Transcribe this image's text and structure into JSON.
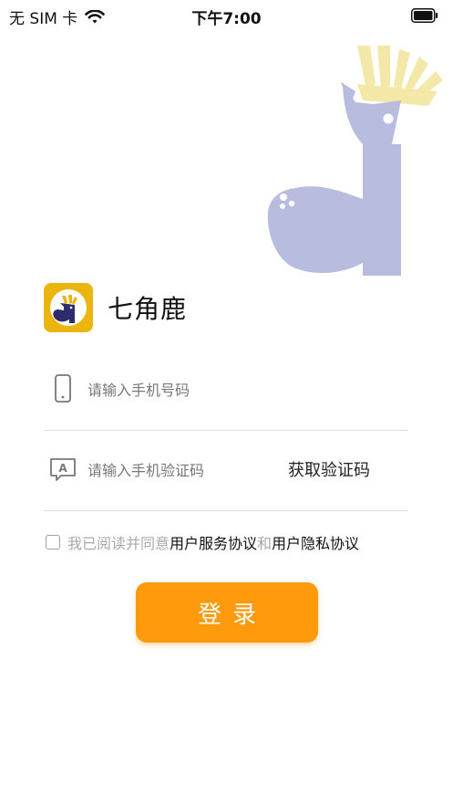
{
  "status_bar": {
    "carrier": "无 SIM 卡",
    "time": "下午7:00",
    "icons": [
      "wifi-icon",
      "battery-icon"
    ]
  },
  "brand": {
    "app_name": "七角鹿",
    "logo_icon": "deer-logo-icon",
    "logo_color": "#ebb40f"
  },
  "form": {
    "phone_placeholder": "请输入手机号码",
    "phone_icon": "phone-icon",
    "code_placeholder": "请输入手机验证码",
    "code_icon": "message-icon",
    "get_code_label": "获取验证码"
  },
  "agreement": {
    "checked": false,
    "prefix": "我已阅读并同意",
    "service_link": "用户服务协议",
    "conjunction": "和",
    "privacy_link": "用户隐私协议"
  },
  "login_button": {
    "label": "登录",
    "color": "#fe9a0c"
  },
  "colors": {
    "deer_body": "#b8bde0",
    "deer_crown": "#f4e8a8"
  }
}
